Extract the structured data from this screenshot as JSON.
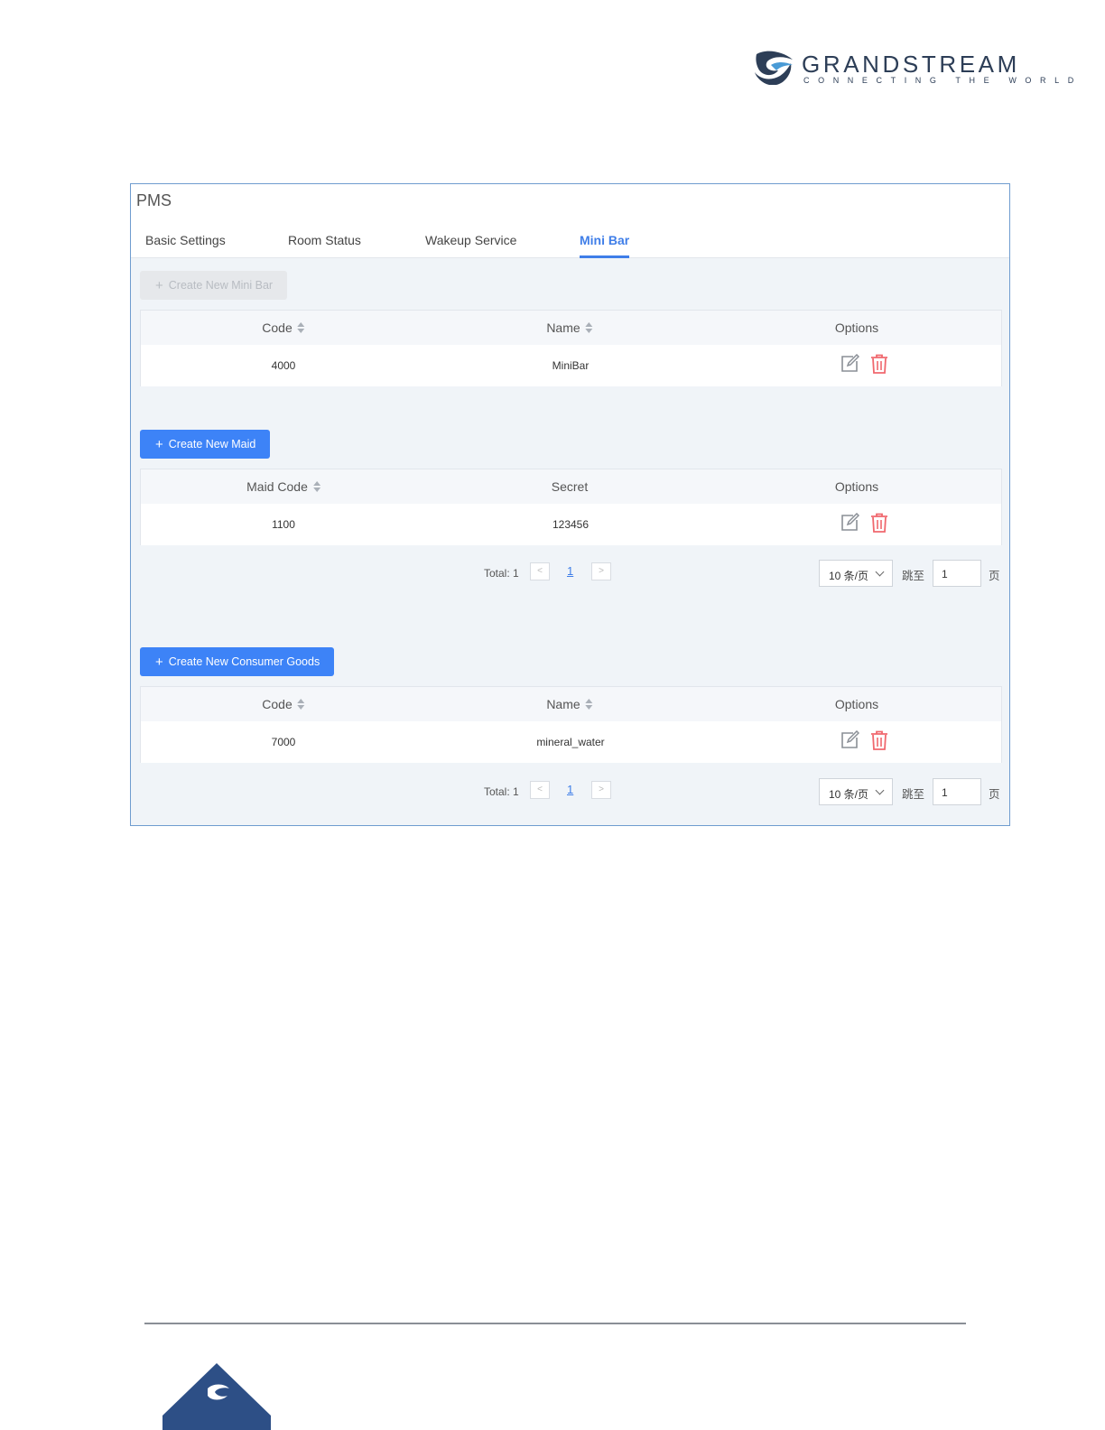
{
  "brand": {
    "name": "GRANDSTREAM",
    "tagline": "CONNECTING THE WORLD",
    "color": "#2d3e57"
  },
  "panel": {
    "title": "PMS",
    "tabs": [
      {
        "label": "Basic Settings",
        "active": false
      },
      {
        "label": "Room Status",
        "active": false
      },
      {
        "label": "Wakeup Service",
        "active": false
      },
      {
        "label": "Mini Bar",
        "active": true
      }
    ],
    "accent": "#3f7ee8"
  },
  "minibar": {
    "create_label": "Create New Mini Bar",
    "columns": [
      "Code",
      "Name",
      "Options"
    ],
    "rows": [
      {
        "code": "4000",
        "name": "MiniBar"
      }
    ]
  },
  "maid": {
    "create_label": "Create New Maid",
    "columns": [
      "Maid Code",
      "Secret",
      "Options"
    ],
    "rows": [
      {
        "code": "1100",
        "secret": "123456"
      }
    ],
    "pager": {
      "total": "Total: 1",
      "page": "1",
      "page_size": "10 条/页",
      "jump_label": "跳至",
      "jump_value": "1",
      "page_suffix": "页",
      "prev": "<",
      "next": ">"
    }
  },
  "goods": {
    "create_label": "Create New Consumer Goods",
    "columns": [
      "Code",
      "Name",
      "Options"
    ],
    "rows": [
      {
        "code": "7000",
        "name": "mineral_water"
      }
    ],
    "pager": {
      "total": "Total: 1",
      "page": "1",
      "page_size": "10 条/页",
      "jump_label": "跳至",
      "jump_value": "1",
      "page_suffix": "页",
      "prev": "<",
      "next": ">"
    }
  },
  "icons": {
    "edit": "edit-icon",
    "delete": "trash-icon",
    "plus": "plus-icon",
    "sort": "sort-icon"
  }
}
